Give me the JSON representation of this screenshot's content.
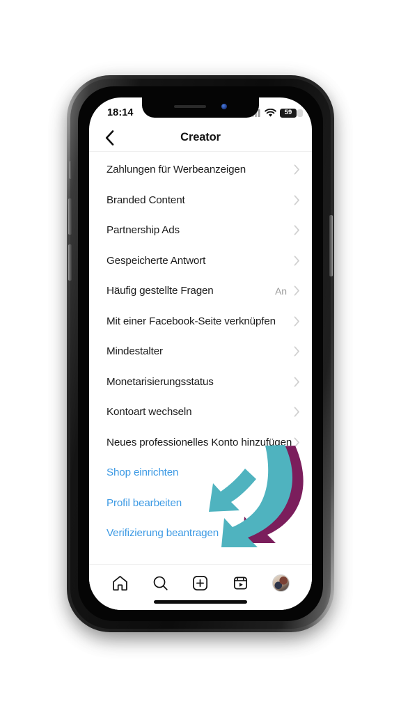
{
  "status_bar": {
    "time": "18:14",
    "cellular_icon": "cellular-bars-icon",
    "wifi_icon": "wifi-icon",
    "battery_icon": "battery-icon",
    "battery_level": "59"
  },
  "header": {
    "back_icon": "chevron-left-icon",
    "title": "Creator"
  },
  "list": {
    "items": [
      {
        "label": "Zahlungen für Werbeanzeigen",
        "value": "",
        "style": "default",
        "chevron": true
      },
      {
        "label": "Branded Content",
        "value": "",
        "style": "default",
        "chevron": true
      },
      {
        "label": "Partnership Ads",
        "value": "",
        "style": "default",
        "chevron": true
      },
      {
        "label": "Gespeicherte Antwort",
        "value": "",
        "style": "default",
        "chevron": true
      },
      {
        "label": "Häufig gestellte Fragen",
        "value": "An",
        "style": "default",
        "chevron": true
      },
      {
        "label": "Mit einer Facebook-Seite verknüpfen",
        "value": "",
        "style": "default",
        "chevron": true
      },
      {
        "label": "Mindestalter",
        "value": "",
        "style": "default",
        "chevron": true
      },
      {
        "label": "Monetarisierungsstatus",
        "value": "",
        "style": "default",
        "chevron": true
      },
      {
        "label": "Kontoart wechseln",
        "value": "",
        "style": "default",
        "chevron": true
      },
      {
        "label": "Neues professionelles Konto hinzufügen",
        "value": "",
        "style": "default",
        "chevron": true
      },
      {
        "label": "Shop einrichten",
        "value": "",
        "style": "link",
        "chevron": false
      },
      {
        "label": "Profil bearbeiten",
        "value": "",
        "style": "link",
        "chevron": false
      },
      {
        "label": "Verifizierung beantragen",
        "value": "",
        "style": "link",
        "chevron": false
      }
    ]
  },
  "tabbar": {
    "items": [
      {
        "icon": "home-icon"
      },
      {
        "icon": "search-icon"
      },
      {
        "icon": "add-post-icon"
      },
      {
        "icon": "reels-icon"
      },
      {
        "icon": "profile-avatar"
      }
    ]
  },
  "annotation": {
    "arrows": [
      {
        "name": "back-arrow-purple",
        "color": "#7B1E5C"
      },
      {
        "name": "front-arrow-teal",
        "color": "#4FB3BF"
      }
    ],
    "points_to": "Verifizierung beantragen"
  },
  "colors": {
    "link_blue": "#3d9ae4",
    "text_dark": "#1c1c1c",
    "value_gray": "#9a9a9a",
    "chevron_gray": "#d0d0d0",
    "arrow_purple": "#7B1E5C",
    "arrow_teal": "#4FB3BF",
    "screen_bg": "#ffffff"
  }
}
